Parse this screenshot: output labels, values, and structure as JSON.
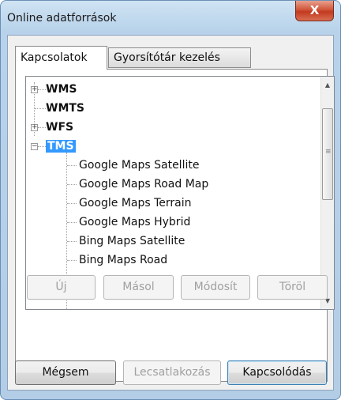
{
  "window": {
    "title": "Online adatforrások",
    "close_glyph": "X"
  },
  "tabs": [
    {
      "label": "Kapcsolatok",
      "active": true
    },
    {
      "label": "Gyorsítótár kezelés",
      "active": false
    }
  ],
  "tree": {
    "roots": [
      {
        "label": "WMS",
        "expander": "+"
      },
      {
        "label": "WMTS",
        "expander": ""
      },
      {
        "label": "WFS",
        "expander": "+"
      },
      {
        "label": "TMS",
        "expander": "−",
        "selected": true
      }
    ],
    "tms_children": [
      "Google Maps Satellite",
      "Google Maps Road Map",
      "Google Maps Terrain",
      "Google Maps Hybrid",
      "Bing Maps Satellite",
      "Bing Maps Road"
    ],
    "scroll_up_glyph": "▲",
    "scroll_down_glyph": "▼",
    "scroll_grip_glyph": "≡"
  },
  "actions": {
    "new": "Új",
    "copy": "Másol",
    "edit": "Módosít",
    "delete": "Töröl"
  },
  "footer": {
    "cancel": "Mégsem",
    "disconnect": "Lecsatlakozás",
    "connect": "Kapcsolódás"
  }
}
